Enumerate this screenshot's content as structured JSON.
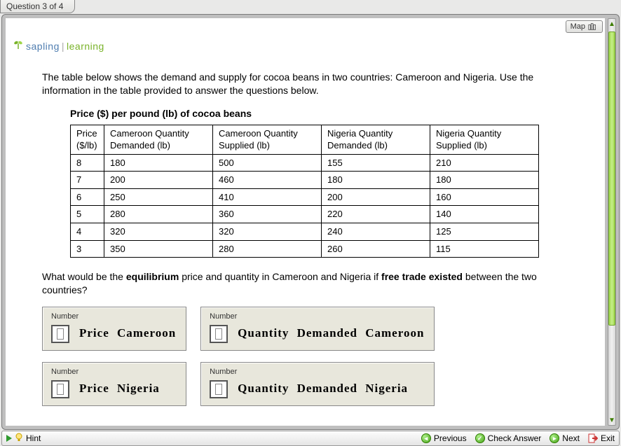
{
  "header": {
    "question_label": "Question 3 of 4",
    "map_label": "Map"
  },
  "brand": {
    "word1": "sapling",
    "word2": "learning"
  },
  "intro": "The table below shows the demand and supply for cocoa beans in two countries: Cameroon and Nigeria. Use the information in the table provided to answer the questions below.",
  "table_title": "Price ($) per pound (lb) of cocoa beans",
  "columns": {
    "price": "Price ($/lb)",
    "cam_d": "Cameroon Quantity Demanded (lb)",
    "cam_s": "Cameroon Quantity Supplied (lb)",
    "nig_d": "Nigeria Quantity Demanded (lb)",
    "nig_s": "Nigeria Quantity Supplied (lb)"
  },
  "rows": [
    {
      "price": "8",
      "cam_d": "180",
      "cam_s": "500",
      "nig_d": "155",
      "nig_s": "210"
    },
    {
      "price": "7",
      "cam_d": "200",
      "cam_s": "460",
      "nig_d": "180",
      "nig_s": "180"
    },
    {
      "price": "6",
      "cam_d": "250",
      "cam_s": "410",
      "nig_d": "200",
      "nig_s": "160"
    },
    {
      "price": "5",
      "cam_d": "280",
      "cam_s": "360",
      "nig_d": "220",
      "nig_s": "140"
    },
    {
      "price": "4",
      "cam_d": "320",
      "cam_s": "320",
      "nig_d": "240",
      "nig_s": "125"
    },
    {
      "price": "3",
      "cam_d": "350",
      "cam_s": "280",
      "nig_d": "260",
      "nig_s": "115"
    }
  ],
  "question_html_parts": {
    "pre": "What would be the ",
    "b1": "equilibrium",
    "mid": " price and quantity in Cameroon and Nigeria if ",
    "b2": "free trade existed",
    "post": " between the two countries?"
  },
  "answer_small_label": "Number",
  "answers": {
    "a1": "Price  Cameroon",
    "a2": "Quantity  Demanded  Cameroon",
    "a3": "Price  Nigeria",
    "a4": "Quantity  Demanded  Nigeria"
  },
  "bottom": {
    "hint": "Hint",
    "previous": "Previous",
    "check": "Check Answer",
    "next": "Next",
    "exit": "Exit"
  },
  "chart_data": {
    "type": "table",
    "title": "Price ($) per pound (lb) of cocoa beans",
    "columns": [
      "Price ($/lb)",
      "Cameroon Quantity Demanded (lb)",
      "Cameroon Quantity Supplied (lb)",
      "Nigeria Quantity Demanded (lb)",
      "Nigeria Quantity Supplied (lb)"
    ],
    "rows": [
      [
        8,
        180,
        500,
        155,
        210
      ],
      [
        7,
        200,
        460,
        180,
        180
      ],
      [
        6,
        250,
        410,
        200,
        160
      ],
      [
        5,
        280,
        360,
        220,
        140
      ],
      [
        4,
        320,
        320,
        240,
        125
      ],
      [
        3,
        350,
        280,
        260,
        115
      ]
    ]
  }
}
